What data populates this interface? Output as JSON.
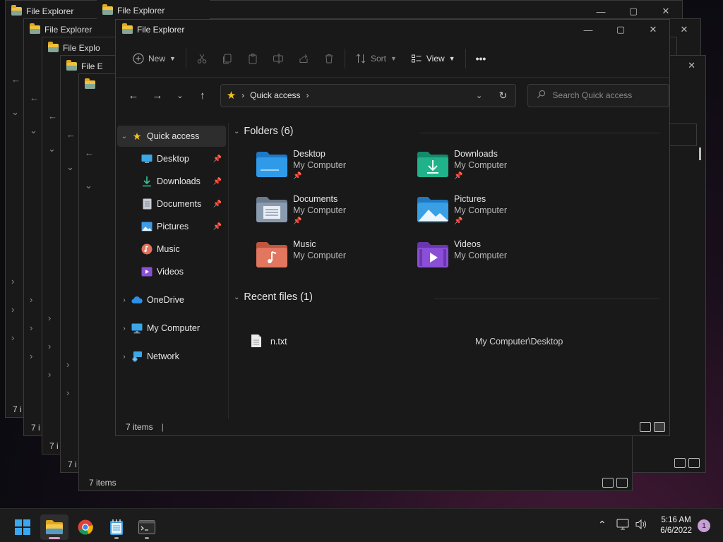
{
  "background_windows": [
    {
      "title": "File Explorer",
      "status": "7 i"
    },
    {
      "title": "File Explorer",
      "status": "7 i"
    },
    {
      "title": "File Explo",
      "status": "7 i"
    },
    {
      "title": "File E",
      "status": "7 i"
    },
    {
      "title": "",
      "status": "7 i"
    },
    {
      "title": "",
      "status": "7 items"
    }
  ],
  "window": {
    "title": "File Explorer",
    "controls": {
      "minimize": "—",
      "maximize": "▢",
      "close": "✕"
    }
  },
  "toolbar": {
    "new_label": "New",
    "sort_label": "Sort",
    "view_label": "View",
    "more_label": "•••"
  },
  "address": {
    "location": "Quick access",
    "search_placeholder": "Search Quick access"
  },
  "sidebar": {
    "quick_access": "Quick access",
    "pinned": [
      {
        "label": "Desktop",
        "icon": "desktop-icon",
        "pinned": true
      },
      {
        "label": "Downloads",
        "icon": "downloads-icon",
        "pinned": true
      },
      {
        "label": "Documents",
        "icon": "documents-icon",
        "pinned": true
      },
      {
        "label": "Pictures",
        "icon": "pictures-icon",
        "pinned": true
      },
      {
        "label": "Music",
        "icon": "music-icon",
        "pinned": false
      },
      {
        "label": "Videos",
        "icon": "videos-icon",
        "pinned": false
      }
    ],
    "onedrive": "OneDrive",
    "my_computer": "My Computer",
    "network": "Network"
  },
  "content": {
    "folders_header": "Folders (6)",
    "folders": [
      {
        "name": "Desktop",
        "location": "My Computer",
        "pinned": true,
        "color": "#2f9be8"
      },
      {
        "name": "Downloads",
        "location": "My Computer",
        "pinned": true,
        "color": "#20b28a"
      },
      {
        "name": "Documents",
        "location": "My Computer",
        "pinned": true,
        "color": "#8a9bb0"
      },
      {
        "name": "Pictures",
        "location": "My Computer",
        "pinned": true,
        "color": "#3aa0e6"
      },
      {
        "name": "Music",
        "location": "My Computer",
        "pinned": false,
        "color": "#e2765e"
      },
      {
        "name": "Videos",
        "location": "My Computer",
        "pinned": false,
        "color": "#8a4fd6"
      }
    ],
    "recent_header": "Recent files (1)",
    "recent": [
      {
        "name": "n.txt",
        "path": "My Computer\\Desktop"
      }
    ]
  },
  "status": {
    "items": "7 items"
  },
  "taskbar": {
    "time": "5:16 AM",
    "date": "6/6/2022",
    "notifications": "1"
  }
}
